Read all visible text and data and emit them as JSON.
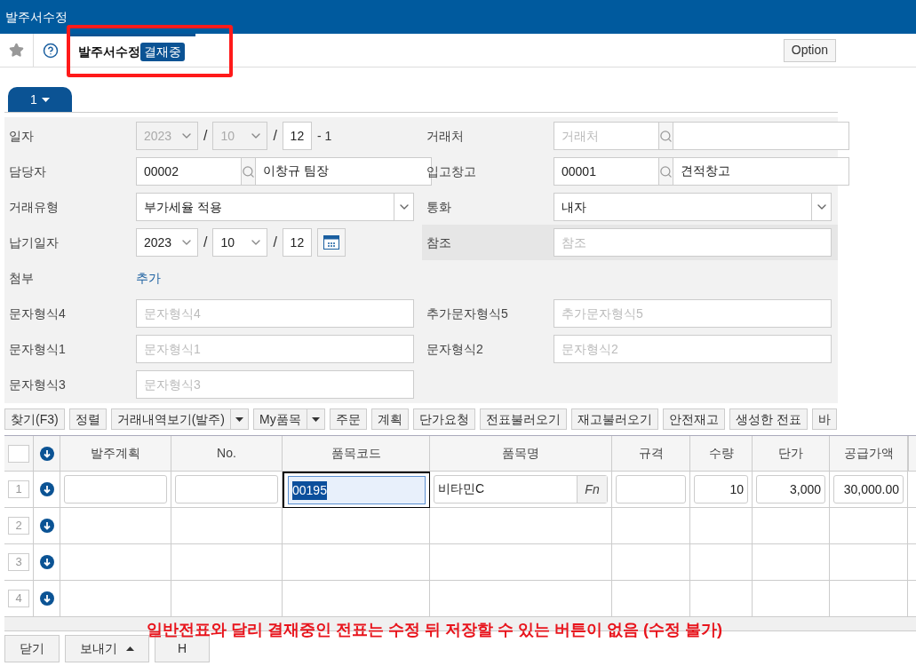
{
  "window": {
    "title": "발주서수정"
  },
  "header": {
    "title": "발주서수정",
    "status_badge": "결재중",
    "option_button": "Option"
  },
  "tabs": [
    {
      "label": "1",
      "selected": true
    }
  ],
  "form": [
    {
      "left": {
        "label": "일자",
        "kind": "date",
        "year": "2023",
        "month": "10",
        "day": "12",
        "separator": "/",
        "suffix": "- 1",
        "disabled": true
      },
      "right": {
        "label": "거래처",
        "kind": "lookup",
        "code_placeholder": "거래처"
      }
    },
    {
      "left": {
        "label": "담당자",
        "kind": "lookup",
        "code": "00002",
        "name": "이창규 팀장"
      },
      "right": {
        "label": "입고창고",
        "kind": "lookup",
        "code": "00001",
        "name": "견적창고"
      }
    },
    {
      "left": {
        "label": "거래유형",
        "kind": "select",
        "value": "부가세율 적용"
      },
      "right": {
        "label": "통화",
        "kind": "select",
        "value": "내자"
      }
    },
    {
      "left": {
        "label": "납기일자",
        "kind": "date",
        "year": "2023",
        "month": "10",
        "day": "12",
        "separator": "/",
        "disabled": false
      },
      "right": {
        "label": "참조",
        "kind": "text",
        "placeholder": "참조",
        "highlighted": true
      }
    },
    {
      "left": {
        "label": "첨부",
        "kind": "link",
        "text": "추가"
      }
    },
    {
      "left": {
        "label": "문자형식4",
        "kind": "text",
        "placeholder": "문자형식4"
      },
      "right": {
        "label": "추가문자형식5",
        "kind": "text",
        "placeholder": "추가문자형식5"
      }
    },
    {
      "left": {
        "label": "문자형식1",
        "kind": "text",
        "placeholder": "문자형식1"
      },
      "right": {
        "label": "문자형식2",
        "kind": "text",
        "placeholder": "문자형식2"
      }
    },
    {
      "left": {
        "label": "문자형식3",
        "kind": "text",
        "placeholder": "문자형식3"
      }
    }
  ],
  "toolbar": [
    {
      "label": "찾기(F3)",
      "dropdown": false
    },
    {
      "label": "정렬",
      "dropdown": false
    },
    {
      "label": "거래내역보기(발주)",
      "dropdown": true
    },
    {
      "label": "My품목",
      "dropdown": true
    },
    {
      "label": "주문",
      "dropdown": false
    },
    {
      "label": "계획",
      "dropdown": false
    },
    {
      "label": "단가요청",
      "dropdown": false
    },
    {
      "label": "전표불러오기",
      "dropdown": false
    },
    {
      "label": "재고불러오기",
      "dropdown": false
    },
    {
      "label": "안전재고",
      "dropdown": false
    },
    {
      "label": "생성한 전표",
      "dropdown": false
    },
    {
      "label": "바",
      "dropdown": false
    }
  ],
  "grid": {
    "select_all_checked": false,
    "columns": [
      "발주계획",
      "No.",
      "품목코드",
      "품목명",
      "규격",
      "수량",
      "단가",
      "공급가액"
    ],
    "rows": [
      {
        "number": "1",
        "cells": {
          "item_code": "00195",
          "item_name": "비타민C",
          "fn": "Fn",
          "quantity": "10",
          "unit_price": "3,000",
          "amount": "30,000.00"
        },
        "focused_code": true
      },
      {
        "number": "2"
      },
      {
        "number": "3"
      },
      {
        "number": "4"
      }
    ]
  },
  "footer_buttons": [
    {
      "label": "닫기",
      "dropup": false
    },
    {
      "label": "보내기",
      "dropup": true
    },
    {
      "label": "H",
      "dropup": false
    }
  ],
  "annotation": {
    "highlight_title": true,
    "note": "일반전표와 달리 결재중인 전표는 수정 뒤 저장할 수 있는 버튼이 없음 (수정 불가)"
  }
}
